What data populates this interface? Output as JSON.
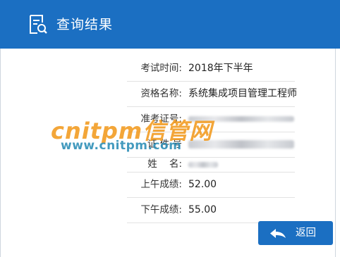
{
  "header": {
    "title": "查询结果",
    "icon": "document-search-icon"
  },
  "fields": [
    {
      "label": "考试时间:",
      "value": "2018年下半年"
    },
    {
      "label": "资格名称:",
      "value": "系统集成项目管理工程师"
    },
    {
      "label": "准考证号:",
      "value": ""
    },
    {
      "label": "证 件 号",
      "value": ""
    },
    {
      "label": "姓    名:",
      "value": ""
    },
    {
      "label": "上午成绩:",
      "value": "52.00"
    },
    {
      "label": "下午成绩:",
      "value": "55.00"
    }
  ],
  "actions": {
    "back_label": "返回"
  },
  "watermark": {
    "brand": "cnitpm信管网",
    "url": "www.cnitpm.com"
  },
  "colors": {
    "header_bg": "#1b6fc2",
    "button_bg": "#1b6fc2",
    "watermark_orange": "#f29a1e",
    "watermark_blue": "#2f90b8"
  }
}
